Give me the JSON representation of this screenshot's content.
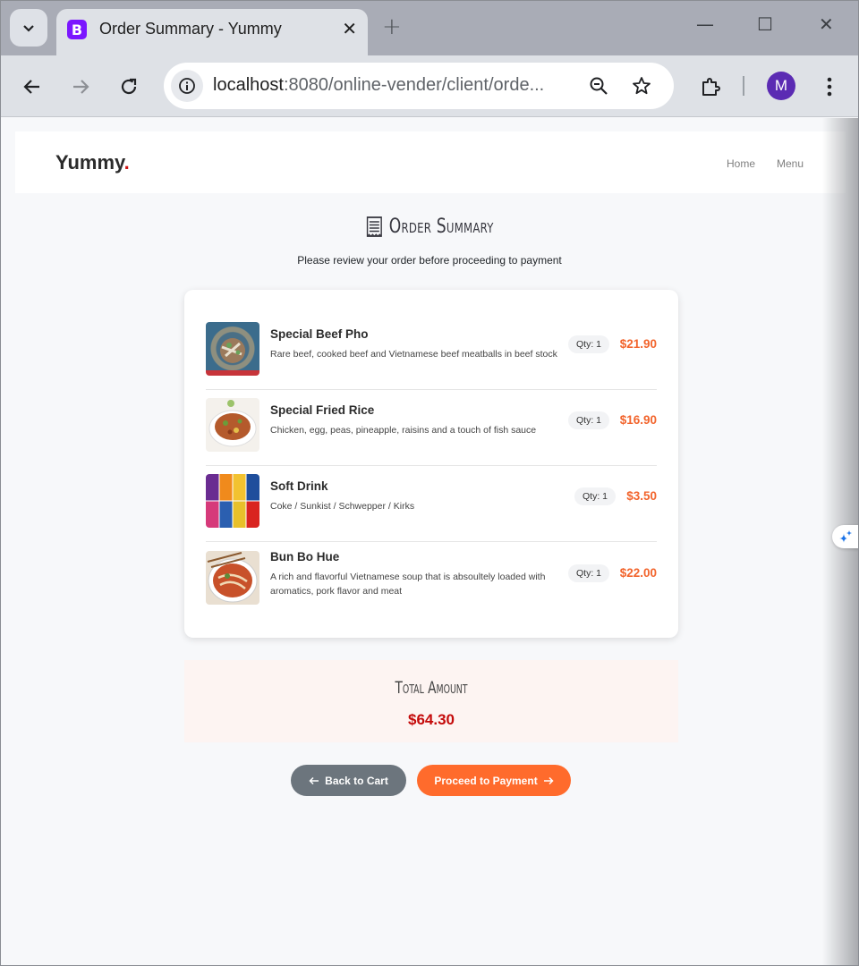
{
  "browser": {
    "tab_title": "Order Summary - Yummy",
    "favicon_letter": "B",
    "url_host": "localhost",
    "url_rest": ":8080/online-vender/client/orde...",
    "profile_initial": "M"
  },
  "header": {
    "logo": "Yummy",
    "logo_dot": ".",
    "nav": {
      "home": "Home",
      "menu": "Menu"
    }
  },
  "summary": {
    "title": "Order Summary",
    "subtitle": "Please review your order before proceeding to payment"
  },
  "items": [
    {
      "name": "Special Beef Pho",
      "description": "Rare beef, cooked beef and Vietnamese beef meatballs in beef stock",
      "qty": "Qty: 1",
      "price": "$21.90"
    },
    {
      "name": "Special Fried Rice",
      "description": "Chicken, egg, peas, pineapple, raisins and a touch of fish sauce",
      "qty": "Qty: 1",
      "price": "$16.90"
    },
    {
      "name": "Soft Drink",
      "description": "Coke / Sunkist / Schwepper / Kirks",
      "qty": "Qty: 1",
      "price": "$3.50"
    },
    {
      "name": "Bun Bo Hue",
      "description": "A rich and flavorful Vietnamese soup that is absoultely loaded with aromatics, pork flavor and meat",
      "qty": "Qty: 1",
      "price": "$22.00"
    }
  ],
  "total": {
    "label": "Total Amount",
    "value": "$64.30"
  },
  "buttons": {
    "back": "Back to Cart",
    "proceed": "Proceed to Payment"
  },
  "colors": {
    "accent": "#ff6b2c",
    "total_value": "#c40a0a",
    "logo_dot": "#ce1212",
    "back_button": "#6c757d"
  },
  "icons": [
    "tab-search-icon",
    "close-icon",
    "new-tab-icon",
    "minimize-icon",
    "maximize-icon",
    "window-close-icon",
    "back-arrow-icon",
    "forward-arrow-icon",
    "reload-icon",
    "site-info-icon",
    "zoom-icon",
    "bookmark-star-icon",
    "extensions-icon",
    "more-vert-icon",
    "receipt-icon",
    "arrow-left-icon",
    "arrow-right-icon"
  ]
}
